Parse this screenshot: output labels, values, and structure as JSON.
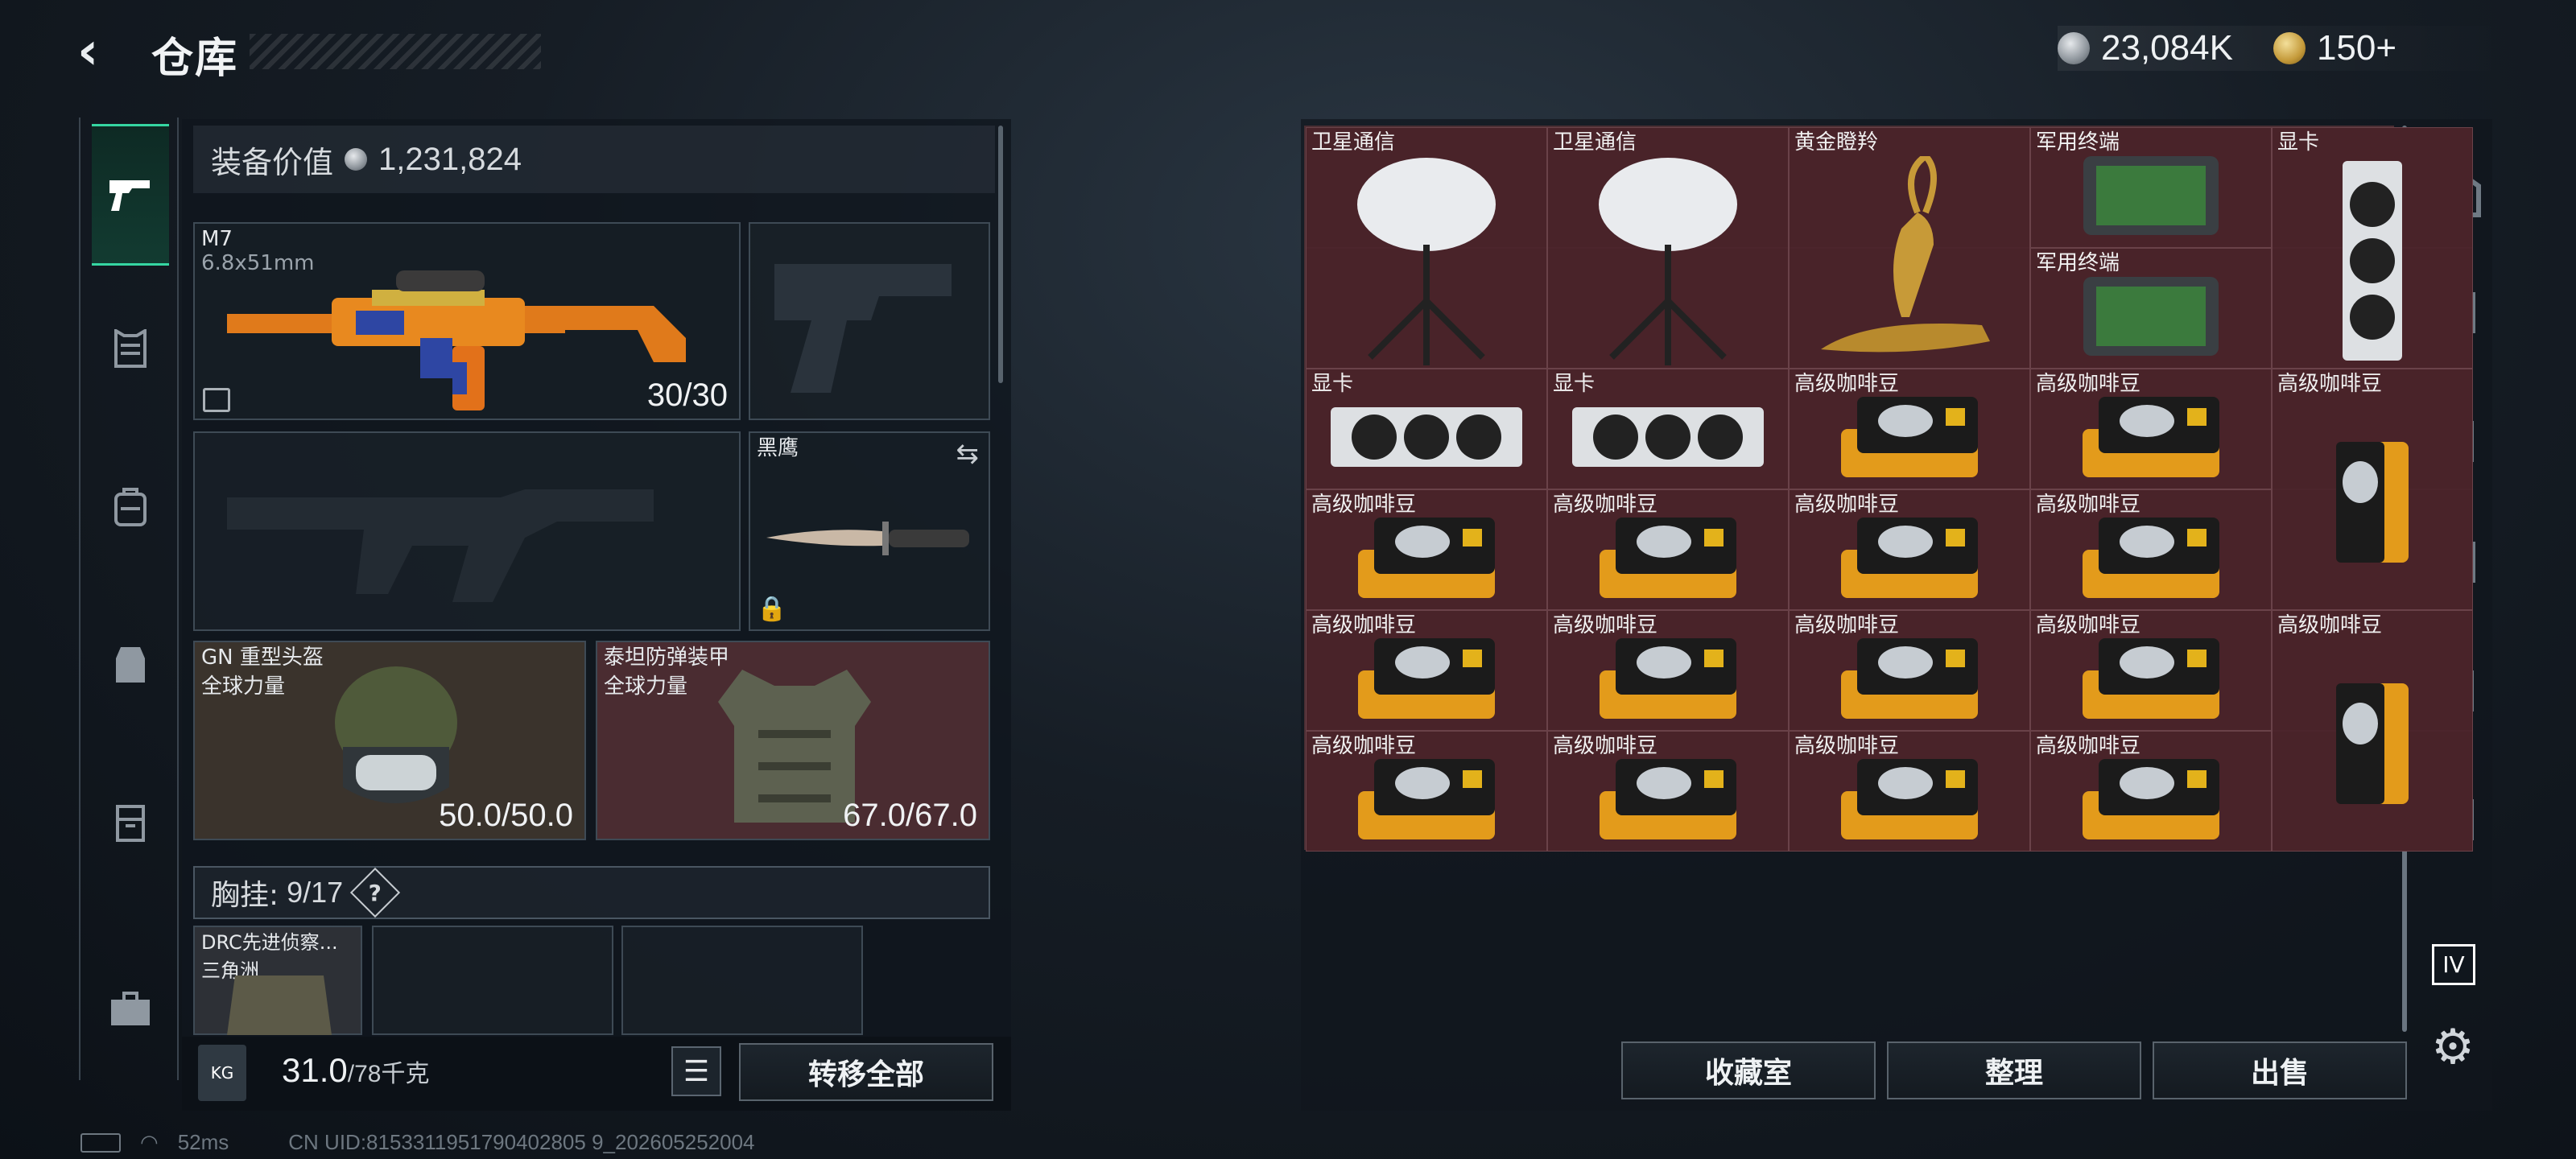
{
  "header": {
    "back_icon": "chevron-left-icon",
    "title": "仓库"
  },
  "currency": {
    "silver": "23,084K",
    "gold": "150+"
  },
  "left_rail": {
    "items": [
      "pistol-icon",
      "armor-icon",
      "backpack-icon",
      "chest-rig-icon",
      "container-icon",
      "briefcase-icon"
    ],
    "active_index": 0
  },
  "equipment": {
    "value_label": "装备价值",
    "value": "1,231,824",
    "primary": {
      "name": "M7",
      "caliber": "6.8x51mm",
      "ammo": "30/30"
    },
    "melee": {
      "name": "黑鹰"
    },
    "helmet": {
      "name": "GN 重型头盔",
      "owner": "全球力量",
      "durability": "50.0/50.0"
    },
    "armor": {
      "name": "泰坦防弹装甲",
      "owner": "全球力量",
      "durability": "67.0/67.0"
    },
    "chest_rig": {
      "label": "胸挂:",
      "capacity": "9/17",
      "help": "?"
    },
    "chest_items": [
      {
        "name": "DRC先进侦察...",
        "owner": "三角洲"
      }
    ]
  },
  "weight": {
    "current": "31.0",
    "max": "/78千克",
    "icon_label": "KG"
  },
  "buttons": {
    "transfer_all": "转移全部",
    "collection": "收藏室",
    "sort": "整理",
    "sell": "出售"
  },
  "stash": {
    "items": [
      {
        "name": "卫星通信",
        "col": 0,
        "row": 0,
        "w": 1,
        "h": 2,
        "kind": "dish"
      },
      {
        "name": "卫星通信",
        "col": 1,
        "row": 0,
        "w": 1,
        "h": 2,
        "kind": "dish"
      },
      {
        "name": "黄金瞪羚",
        "col": 2,
        "row": 0,
        "w": 1,
        "h": 2,
        "kind": "gazelle"
      },
      {
        "name": "军用终端",
        "col": 3,
        "row": 0,
        "w": 1,
        "h": 1,
        "kind": "terminal"
      },
      {
        "name": "军用终端",
        "col": 3,
        "row": 1,
        "w": 1,
        "h": 1,
        "kind": "terminal"
      },
      {
        "name": "显卡",
        "col": 4,
        "row": 0,
        "w": 1,
        "h": 2,
        "kind": "gpuv"
      },
      {
        "name": "显卡",
        "col": 0,
        "row": 2,
        "w": 1,
        "h": 1,
        "kind": "gpu"
      },
      {
        "name": "显卡",
        "col": 1,
        "row": 2,
        "w": 1,
        "h": 1,
        "kind": "gpu"
      },
      {
        "name": "高级咖啡豆",
        "col": 2,
        "row": 2,
        "w": 1,
        "h": 1,
        "kind": "coffee"
      },
      {
        "name": "高级咖啡豆",
        "col": 3,
        "row": 2,
        "w": 1,
        "h": 1,
        "kind": "coffee"
      },
      {
        "name": "高级咖啡豆",
        "col": 4,
        "row": 2,
        "w": 1,
        "h": 2,
        "kind": "coffeev"
      },
      {
        "name": "高级咖啡豆",
        "col": 0,
        "row": 3,
        "w": 1,
        "h": 1,
        "kind": "coffee"
      },
      {
        "name": "高级咖啡豆",
        "col": 1,
        "row": 3,
        "w": 1,
        "h": 1,
        "kind": "coffee"
      },
      {
        "name": "高级咖啡豆",
        "col": 2,
        "row": 3,
        "w": 1,
        "h": 1,
        "kind": "coffee"
      },
      {
        "name": "高级咖啡豆",
        "col": 3,
        "row": 3,
        "w": 1,
        "h": 1,
        "kind": "coffee"
      },
      {
        "name": "高级咖啡豆",
        "col": 0,
        "row": 4,
        "w": 1,
        "h": 1,
        "kind": "coffee"
      },
      {
        "name": "高级咖啡豆",
        "col": 1,
        "row": 4,
        "w": 1,
        "h": 1,
        "kind": "coffee"
      },
      {
        "name": "高级咖啡豆",
        "col": 2,
        "row": 4,
        "w": 1,
        "h": 1,
        "kind": "coffee"
      },
      {
        "name": "高级咖啡豆",
        "col": 3,
        "row": 4,
        "w": 1,
        "h": 1,
        "kind": "coffee"
      },
      {
        "name": "高级咖啡豆",
        "col": 4,
        "row": 4,
        "w": 1,
        "h": 2,
        "kind": "coffeev"
      },
      {
        "name": "高级咖啡豆",
        "col": 0,
        "row": 5,
        "w": 1,
        "h": 1,
        "kind": "coffee"
      },
      {
        "name": "高级咖啡豆",
        "col": 1,
        "row": 5,
        "w": 1,
        "h": 1,
        "kind": "coffee"
      },
      {
        "name": "高级咖啡豆",
        "col": 2,
        "row": 5,
        "w": 1,
        "h": 1,
        "kind": "coffee"
      },
      {
        "name": "高级咖啡豆",
        "col": 3,
        "row": 5,
        "w": 1,
        "h": 1,
        "kind": "coffee"
      }
    ]
  },
  "right_rail": {
    "items": [
      "safe-house-icon",
      "level-iv-case-icon",
      "level-iii-case-icon",
      "level-iv-box-icon",
      "level-iii-box-icon",
      "level-iii-crate-icon",
      "level-iv-crate-icon"
    ]
  },
  "status": {
    "ping": "52ms",
    "uid": "CN UID:8153311951790402805 9_202605252004"
  }
}
